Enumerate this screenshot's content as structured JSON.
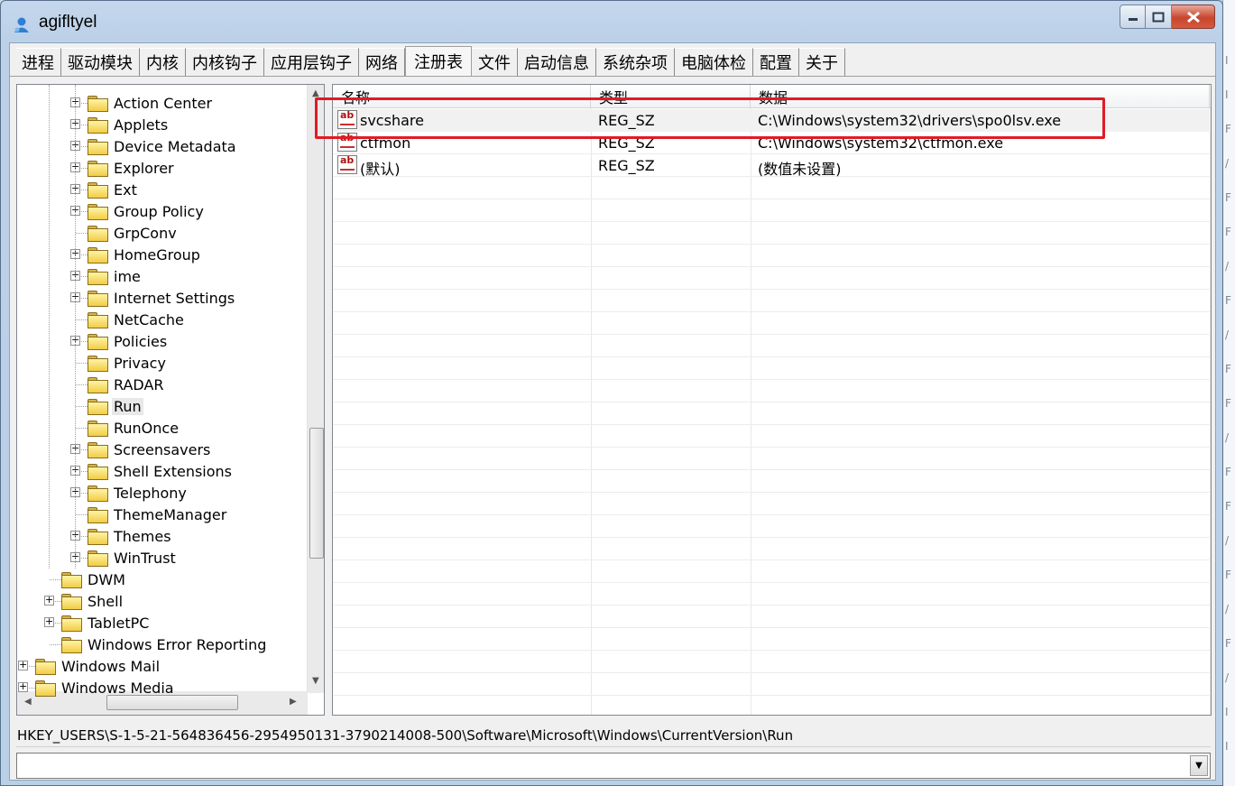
{
  "window": {
    "title": "agifltyel"
  },
  "tabs": [
    {
      "label": "进程"
    },
    {
      "label": "驱动模块"
    },
    {
      "label": "内核"
    },
    {
      "label": "内核钩子"
    },
    {
      "label": "应用层钩子"
    },
    {
      "label": "网络"
    },
    {
      "label": "注册表"
    },
    {
      "label": "文件"
    },
    {
      "label": "启动信息"
    },
    {
      "label": "系统杂项"
    },
    {
      "label": "电脑体检"
    },
    {
      "label": "配置"
    },
    {
      "label": "关于"
    }
  ],
  "active_tab": "注册表",
  "tree": {
    "items": [
      {
        "label": "Action Center",
        "expandable": true
      },
      {
        "label": "Applets",
        "expandable": true
      },
      {
        "label": "Device Metadata",
        "expandable": true
      },
      {
        "label": "Explorer",
        "expandable": true
      },
      {
        "label": "Ext",
        "expandable": true
      },
      {
        "label": "Group Policy",
        "expandable": true
      },
      {
        "label": "GrpConv",
        "expandable": false
      },
      {
        "label": "HomeGroup",
        "expandable": true
      },
      {
        "label": "ime",
        "expandable": true
      },
      {
        "label": "Internet Settings",
        "expandable": true
      },
      {
        "label": "NetCache",
        "expandable": false
      },
      {
        "label": "Policies",
        "expandable": true
      },
      {
        "label": "Privacy",
        "expandable": false
      },
      {
        "label": "RADAR",
        "expandable": false
      },
      {
        "label": "Run",
        "expandable": false,
        "selected": true
      },
      {
        "label": "RunOnce",
        "expandable": false
      },
      {
        "label": "Screensavers",
        "expandable": true
      },
      {
        "label": "Shell Extensions",
        "expandable": true
      },
      {
        "label": "Telephony",
        "expandable": true
      },
      {
        "label": "ThemeManager",
        "expandable": false
      },
      {
        "label": "Themes",
        "expandable": true
      },
      {
        "label": "WinTrust",
        "expandable": true
      },
      {
        "label": "DWM",
        "expandable": false
      },
      {
        "label": "Shell",
        "expandable": true
      },
      {
        "label": "TabletPC",
        "expandable": true
      },
      {
        "label": "Windows Error Reporting",
        "expandable": false
      },
      {
        "label": "Windows Mail",
        "expandable": true
      },
      {
        "label": "Windows Media",
        "expandable": true
      }
    ]
  },
  "list": {
    "columns": [
      {
        "label": "名称"
      },
      {
        "label": "类型"
      },
      {
        "label": "数据"
      }
    ],
    "rows": [
      {
        "name": "svcshare",
        "type": "REG_SZ",
        "data": "C:\\Windows\\system32\\drivers\\spo0lsv.exe",
        "selected": true
      },
      {
        "name": "ctfmon",
        "type": "REG_SZ",
        "data": "C:\\Windows\\system32\\ctfmon.exe"
      },
      {
        "name": "(默认)",
        "type": "REG_SZ",
        "data": "(数值未设置)"
      }
    ],
    "icon": {
      "name": "reg-string-icon",
      "text": "ab"
    }
  },
  "status": {
    "path": "HKEY_USERS\\S-1-5-21-564836456-2954950131-3790214008-500\\Software\\Microsoft\\Windows\\CurrentVersion\\Run"
  },
  "combo": {
    "value": ""
  },
  "highlight_color": "#e01b24",
  "background_strip": [
    "I",
    "I",
    "F",
    "/",
    "F",
    "F",
    "/",
    "F",
    "/",
    "F",
    "F",
    "/",
    "F",
    "F",
    "/",
    "F",
    "/",
    "F",
    "/",
    "I",
    "I"
  ]
}
